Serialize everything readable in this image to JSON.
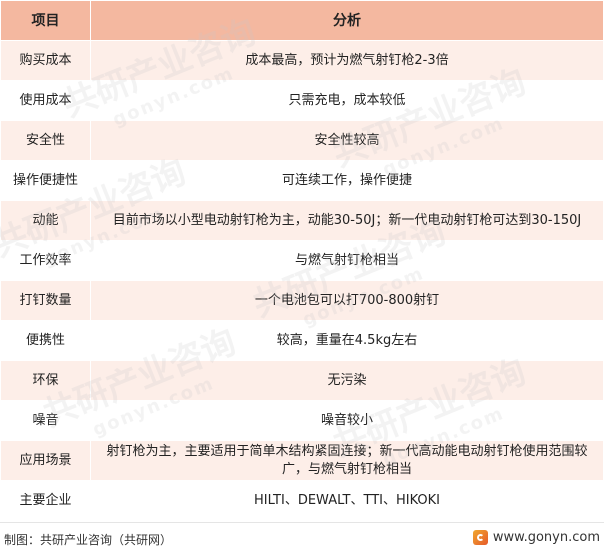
{
  "table": {
    "header": {
      "col1": "项目",
      "col2": "分析"
    },
    "rows": [
      {
        "item": "购买成本",
        "analysis": "成本最高，预计为燃气射钉枪2-3倍"
      },
      {
        "item": "使用成本",
        "analysis": "只需充电，成本较低"
      },
      {
        "item": "安全性",
        "analysis": "安全性较高"
      },
      {
        "item": "操作便捷性",
        "analysis": "可连续工作，操作便捷"
      },
      {
        "item": "动能",
        "analysis": "目前市场以小型电动射钉枪为主，动能30-50J；新一代电动射钉枪可达到30-150J"
      },
      {
        "item": "工作效率",
        "analysis": "与燃气射钉枪相当"
      },
      {
        "item": "打钉数量",
        "analysis": "一个电池包可以打700-800射钉"
      },
      {
        "item": "便携性",
        "analysis": "较高，重量在4.5kg左右"
      },
      {
        "item": "环保",
        "analysis": "无污染"
      },
      {
        "item": "噪音",
        "analysis": "噪音较小"
      },
      {
        "item": "应用场景",
        "analysis": "射钉枪为主，主要适用于简单木结构紧固连接；新一代高动能电动射钉枪使用范围较广，与燃气射钉枪相当"
      },
      {
        "item": "主要企业",
        "analysis": "HILTI、DEWALT、TTI、HIKOKI"
      }
    ]
  },
  "footer": {
    "source": "制图：共研产业咨询（共研网）",
    "brand": "www.gonyn.com"
  },
  "watermark": {
    "text": "共研产业咨询",
    "url": "gonyn.com"
  },
  "colors": {
    "header_bg": "#f4b8a0",
    "row_tint": "#fdeee8",
    "logo": "#e65a2a"
  }
}
